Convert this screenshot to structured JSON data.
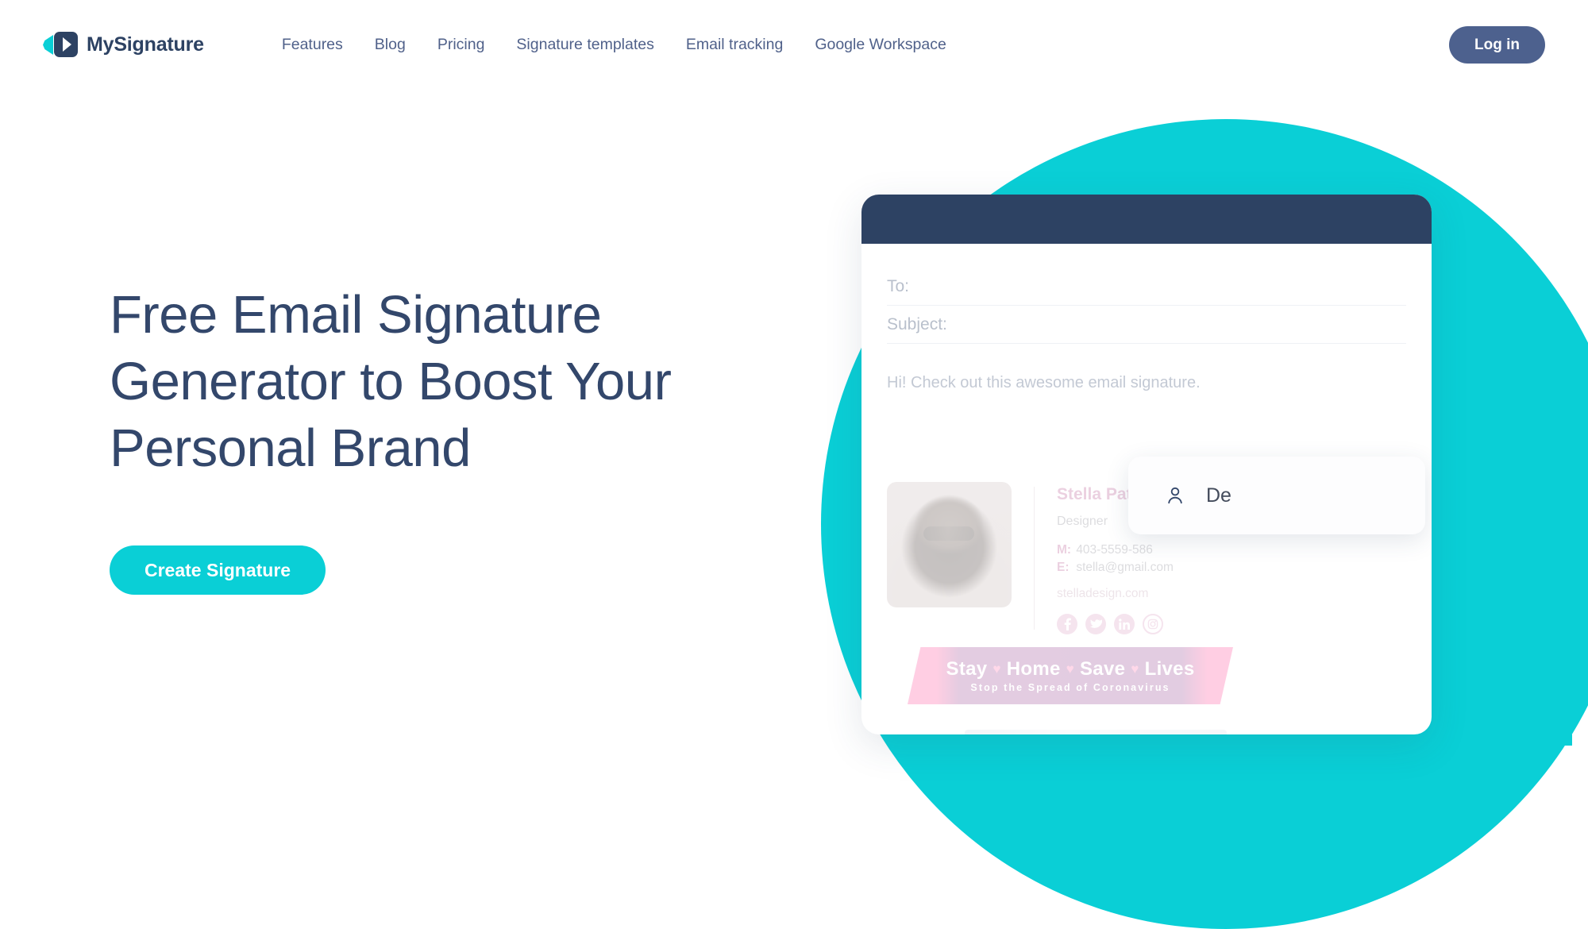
{
  "brand": {
    "name": "MySignature",
    "mark_teal": "#0ACFD6",
    "mark_navy": "#2D4263"
  },
  "header": {
    "nav": [
      {
        "label": "Features"
      },
      {
        "label": "Blog"
      },
      {
        "label": "Pricing"
      },
      {
        "label": "Signature templates"
      },
      {
        "label": "Email tracking"
      },
      {
        "label": "Google Workspace"
      }
    ],
    "login_label": "Log in",
    "login_bg": "#4D618E"
  },
  "hero": {
    "title": "Free Email Signature Generator to Boost Your Personal Brand",
    "cta_label": "Create Signature",
    "cta_bg": "#0ACFD6",
    "title_color": "#33476B"
  },
  "mockup": {
    "header_bg": "#2D4263",
    "blob_color": "#0ACFD6",
    "fields": [
      {
        "label": "To:"
      },
      {
        "label": "Subject:"
      }
    ],
    "message": "Hi! Check out this awesome email signature.",
    "autocomplete": {
      "icon": "person-icon",
      "text": "De"
    },
    "signature": {
      "name": "Stella Paterson",
      "role": "Designer",
      "contacts": [
        {
          "key": "M:",
          "value": "403-5559-586"
        },
        {
          "key": "E:",
          "value": "stella@gmail.com"
        }
      ],
      "website": "stelladesign.com",
      "name_color": "#C0679C",
      "socials": [
        {
          "icon": "facebook-icon"
        },
        {
          "icon": "twitter-icon"
        },
        {
          "icon": "linkedin-icon"
        },
        {
          "icon": "instagram-icon"
        }
      ]
    },
    "banner": {
      "line1_parts": [
        "Stay",
        "Home",
        "Save",
        "Lives"
      ],
      "line1": "Stay ♥ Home ♥ Save ♥ Lives",
      "line2": "Stop the Spread of Coronavirus"
    }
  }
}
